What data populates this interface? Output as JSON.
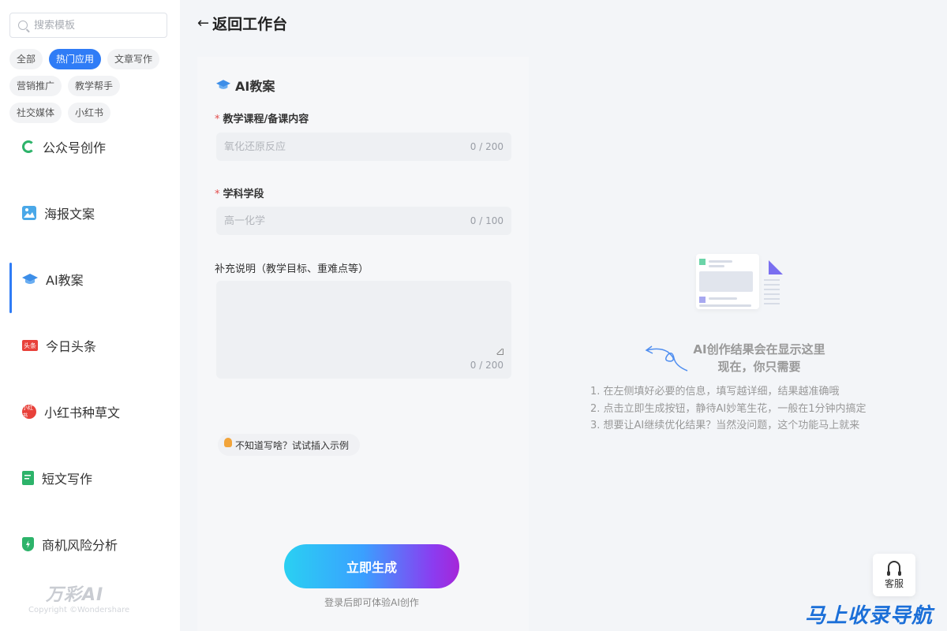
{
  "sidebar": {
    "search_placeholder": "搜索模板",
    "tags": [
      {
        "label": "全部",
        "active": false
      },
      {
        "label": "热门应用",
        "active": true
      },
      {
        "label": "文章写作",
        "active": false
      },
      {
        "label": "营销推广",
        "active": false
      },
      {
        "label": "教学帮手",
        "active": false
      },
      {
        "label": "社交媒体",
        "active": false
      },
      {
        "label": "小红书",
        "active": false
      }
    ],
    "items": [
      {
        "label": "公众号创作",
        "icon": "wechat-icon"
      },
      {
        "label": "海报文案",
        "icon": "poster-icon"
      },
      {
        "label": "AI教案",
        "icon": "graduation-cap-icon",
        "active": true
      },
      {
        "label": "今日头条",
        "icon": "toutiao-icon"
      },
      {
        "label": "小红书种草文",
        "icon": "xiaohongshu-icon"
      },
      {
        "label": "短文写作",
        "icon": "document-icon"
      },
      {
        "label": "商机风险分析",
        "icon": "shield-icon"
      }
    ],
    "logo_text": "万彩AI",
    "copyright": "Copyright ©Wondershare"
  },
  "header": {
    "back_label": "返回工作台"
  },
  "form": {
    "title": "AI教案",
    "fields": [
      {
        "label": "教学课程/备课内容",
        "required": true,
        "placeholder": "氧化还原反应",
        "counter": "0 / 200"
      },
      {
        "label": "学科学段",
        "required": true,
        "placeholder": "高一化学",
        "counter": "0 / 100"
      },
      {
        "label": "补充说明（教学目标、重难点等）",
        "required": false,
        "placeholder": "",
        "counter": "0 / 200"
      }
    ],
    "hint": "不知道写啥？试试插入示例",
    "generate_label": "立即生成",
    "login_tip": "登录后即可体验AI创作"
  },
  "result": {
    "title_line1": "AI创作结果会在显示这里",
    "title_line2": "现在，你只需要",
    "steps": [
      "1. 在左侧填好必要的信息，填写越详细，结果越准确哦",
      "2. 点击立即生成按钮，静待AI妙笔生花，一般在1分钟内搞定",
      "3. 想要让AI继续优化结果？当然没问题，这个功能马上就来"
    ]
  },
  "service": {
    "label": "客服"
  },
  "watermark": "马上收录导航",
  "colors": {
    "accent": "#2f7cf6",
    "required": "#e34d4d",
    "gradient_start": "#2ad0f2",
    "gradient_end": "#a526d8"
  }
}
